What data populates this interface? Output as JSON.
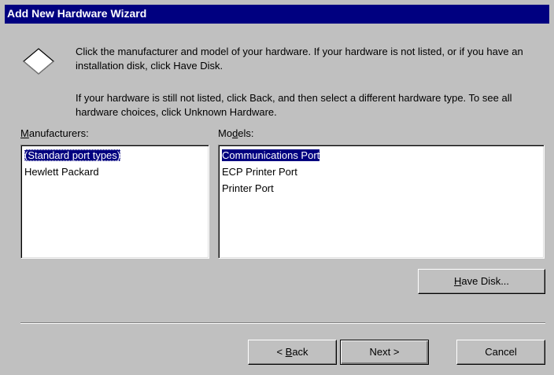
{
  "window": {
    "title": "Add New Hardware Wizard"
  },
  "instructions": {
    "paragraph1": "Click the manufacturer and model of your hardware. If your hardware is not listed, or if you have an installation disk, click Have Disk.",
    "paragraph2": "If your hardware is still not listed, click Back, and then select a different hardware type. To see all hardware choices, click Unknown Hardware."
  },
  "manufacturers": {
    "label_mnemonic": "M",
    "label_rest": "anufacturers:",
    "items": [
      {
        "label": "(Standard port types)",
        "selected": true
      },
      {
        "label": "Hewlett Packard",
        "selected": false
      }
    ]
  },
  "models": {
    "label_pre": "Mo",
    "label_mnemonic": "d",
    "label_post": "els:",
    "items": [
      {
        "label": "Communications Port",
        "selected": true
      },
      {
        "label": "ECP Printer Port",
        "selected": false
      },
      {
        "label": "Printer Port",
        "selected": false
      }
    ]
  },
  "buttons": {
    "have_disk_mnemonic": "H",
    "have_disk_rest": "ave Disk...",
    "back_prefix": "< ",
    "back_mnemonic": "B",
    "back_rest": "ack",
    "next": "Next >",
    "cancel": "Cancel"
  },
  "icons": {
    "wizard": "diamond-icon"
  }
}
